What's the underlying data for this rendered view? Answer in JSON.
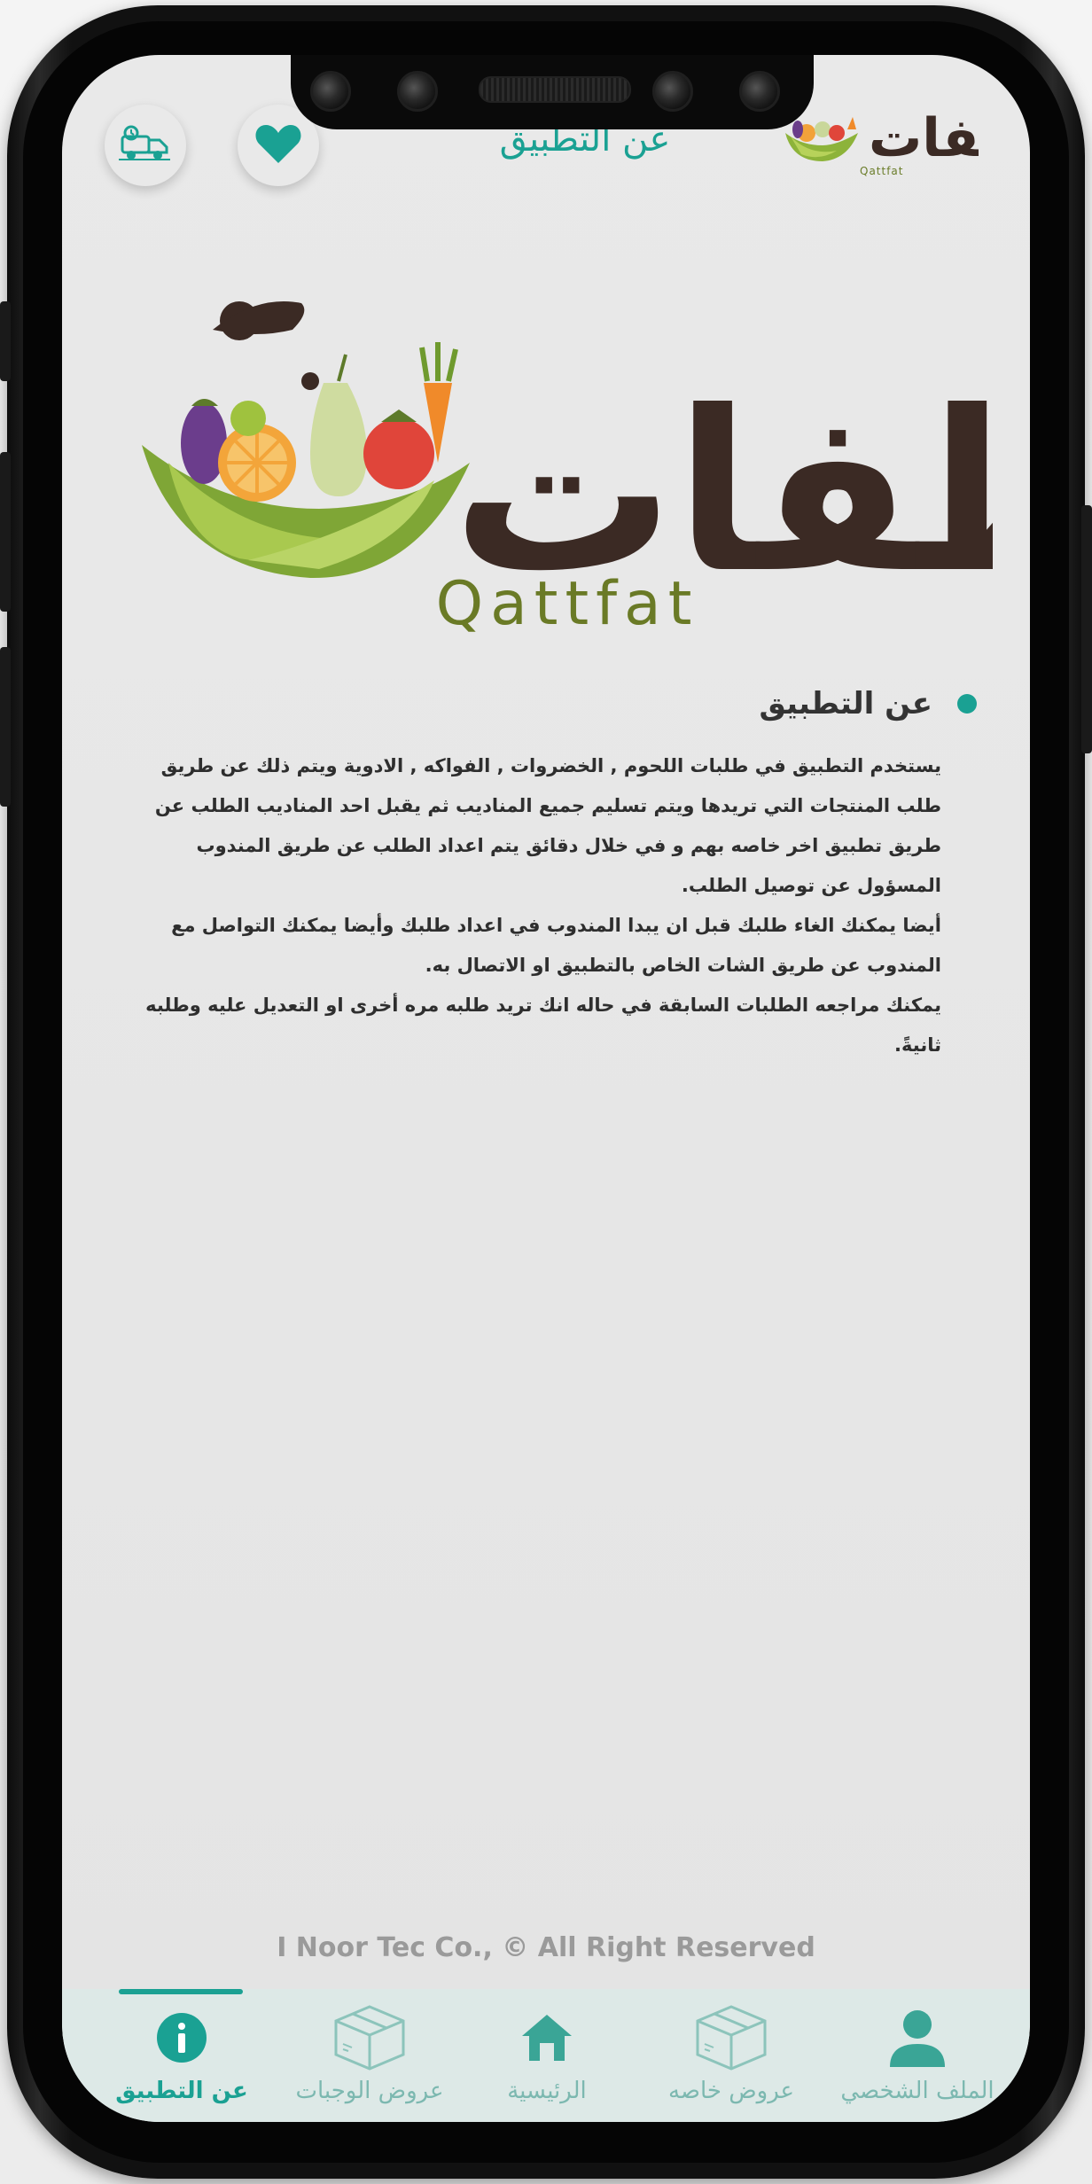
{
  "header": {
    "title": "عن التطبيق",
    "logo_text": "قطفات",
    "logo_subtext": "Qattfat"
  },
  "logo": {
    "arabic": "قطفات",
    "latin": "Qattfat"
  },
  "about": {
    "heading": "عن التطبيق",
    "paragraphs": [
      "يستخدم التطبيق في طلبات اللحوم , الخضروات , الفواكه , الادوية  ويتم ذلك عن طريق طلب المنتجات التي تريدها ويتم تسليم جميع المناديب  ثم يقبل احد المناديب الطلب عن طريق تطبيق اخر خاصه بهم و في خلال دقائق يتم اعداد الطلب عن طريق المندوب المسؤول عن توصيل الطلب.",
      "أيضا يمكنك الغاء طلبك قبل ان يبدا المندوب في اعداد طلبك وأيضا يمكنك التواصل مع المندوب عن طريق الشات الخاص بالتطبيق او الاتصال به.",
      "يمكنك مراجعه الطلبات السابقة في حاله انك تريد طلبه مره أخرى او التعديل عليه وطلبه ثانيةً."
    ]
  },
  "footer": {
    "copyright": "I Noor Tec Co.,   © All Right Reserved"
  },
  "nav": {
    "items": [
      {
        "label": "عن التطبيق",
        "icon": "info-icon",
        "active": true
      },
      {
        "label": "عروض الوجبات",
        "icon": "box-icon",
        "active": false
      },
      {
        "label": "الرئيسية",
        "icon": "home-icon",
        "active": false
      },
      {
        "label": "عروض خاصه",
        "icon": "box-icon",
        "active": false
      },
      {
        "label": "الملف الشخصي",
        "icon": "person-icon",
        "active": false
      }
    ]
  },
  "colors": {
    "accent": "#1aa193",
    "nav_inactive": "#7cb8b0",
    "logo_brown": "#3b2a24",
    "logo_green": "#6a7a26"
  }
}
